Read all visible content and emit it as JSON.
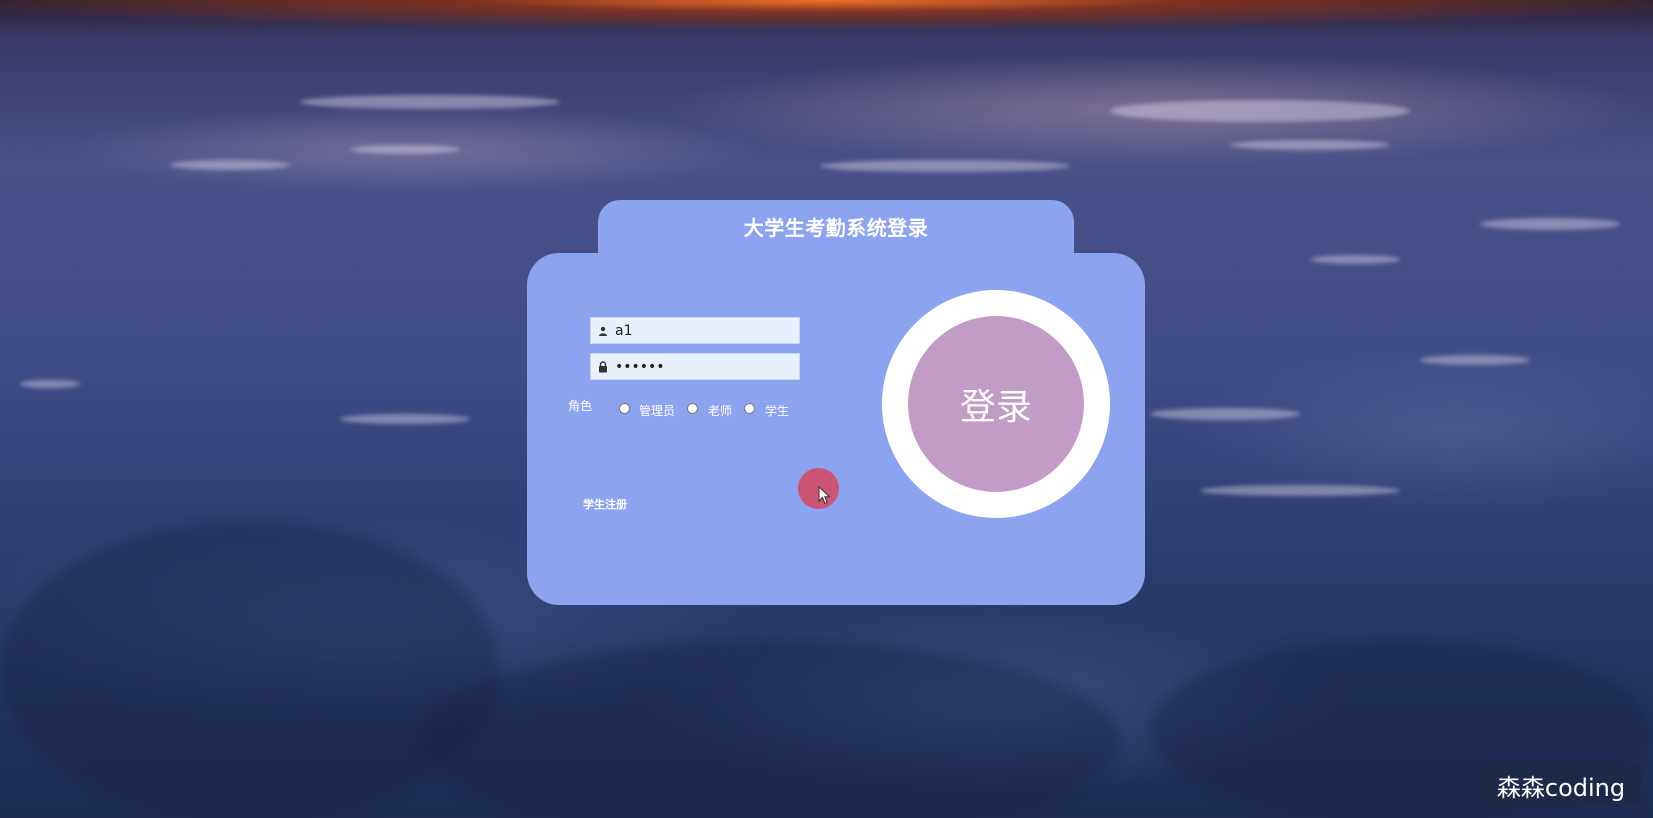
{
  "login": {
    "title": "大学生考勤系统登录",
    "username_value": "a1",
    "password_value": "••••••",
    "role_label": "角色",
    "roles": [
      "管理员",
      "老师",
      "学生"
    ],
    "register_link": "学生注册",
    "submit_label": "登录"
  },
  "watermark": "森森coding",
  "colors": {
    "card": "#8ca3f0",
    "login_button": "#c29bc7",
    "ring": "#ffffff",
    "input_bg": "#e8f0fe",
    "cursor_highlight": "#d7465f"
  },
  "icons": {
    "username": "user-icon",
    "password": "lock-icon",
    "cursor": "mouse-pointer-icon"
  }
}
